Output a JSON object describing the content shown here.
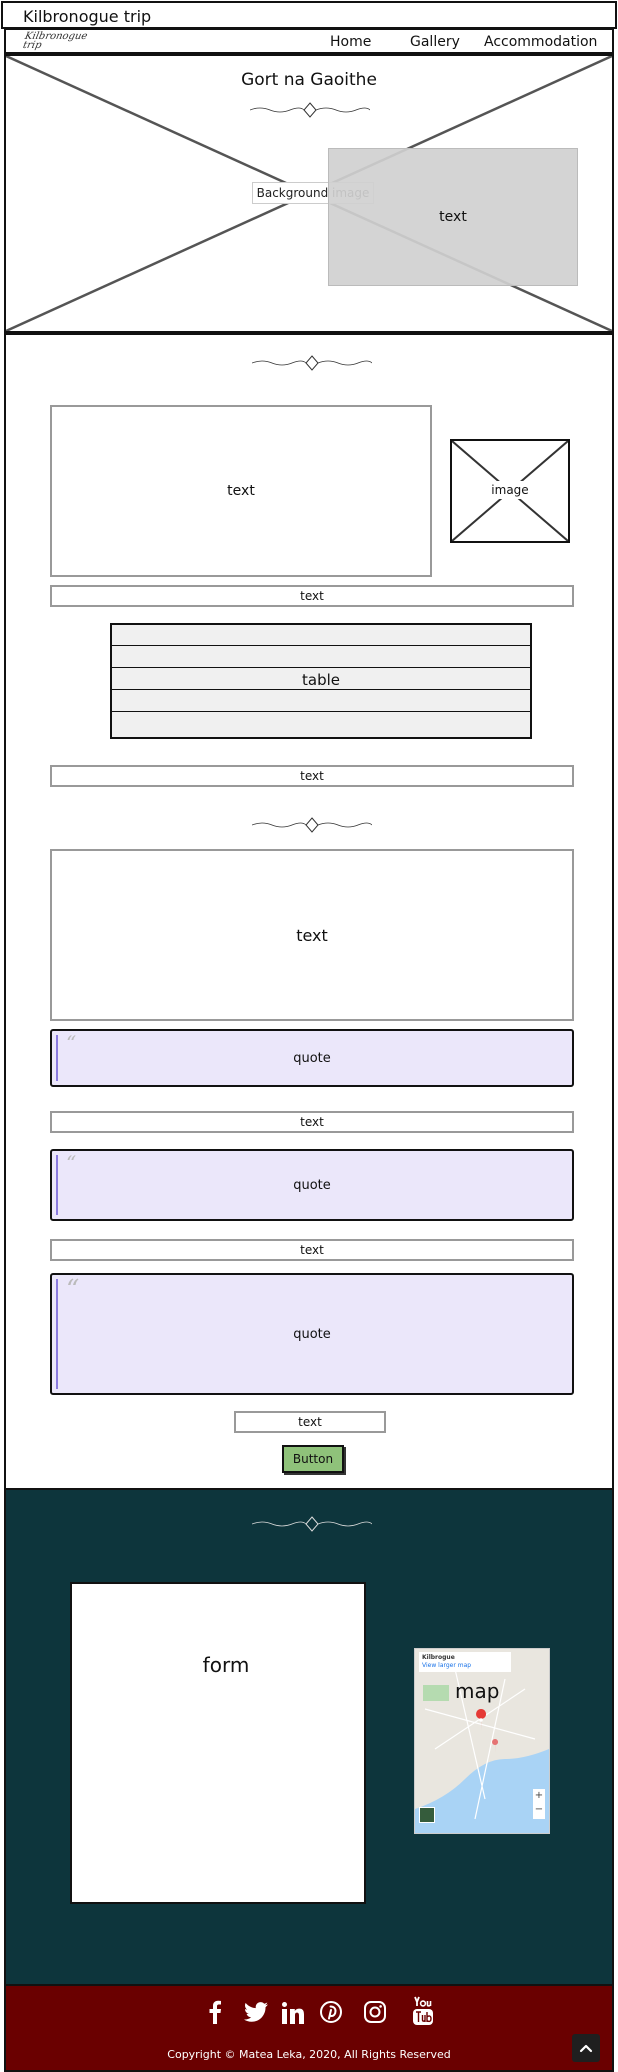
{
  "window": {
    "title": "Kilbronogue trip"
  },
  "nav": {
    "logo": "Kilbronogue\ntrip",
    "items": [
      "Home",
      "Gallery",
      "Accommodation"
    ]
  },
  "hero": {
    "title": "Gort na Gaoithe",
    "background_label": "Background image",
    "text_label": "text"
  },
  "main": {
    "intro_text": "text",
    "image_label": "image",
    "text_bar_1": "text",
    "table_label": "table",
    "text_bar_2": "text",
    "section_text": "text",
    "quote_1": "quote",
    "text_bar_3": "text",
    "quote_2": "quote",
    "text_bar_4": "text",
    "quote_3": "quote",
    "text_bar_5": "text",
    "button_label": "Button"
  },
  "contact": {
    "form_label": "form",
    "map_label": "map",
    "map_card_title": "Kilbrogue",
    "map_card_sub": "View larger map"
  },
  "footer": {
    "social": [
      "facebook-icon",
      "twitter-icon",
      "linkedin-icon",
      "pinterest-icon",
      "instagram-icon",
      "youtube-icon"
    ],
    "copyright": "Copyright © Matea Leka, 2020, All Rights Reserved"
  },
  "colors": {
    "contact_bg": "#0d353c",
    "footer_bg": "#6a0000",
    "quote_bg": "#ebe7fa",
    "button_bg": "#8fc27a"
  }
}
